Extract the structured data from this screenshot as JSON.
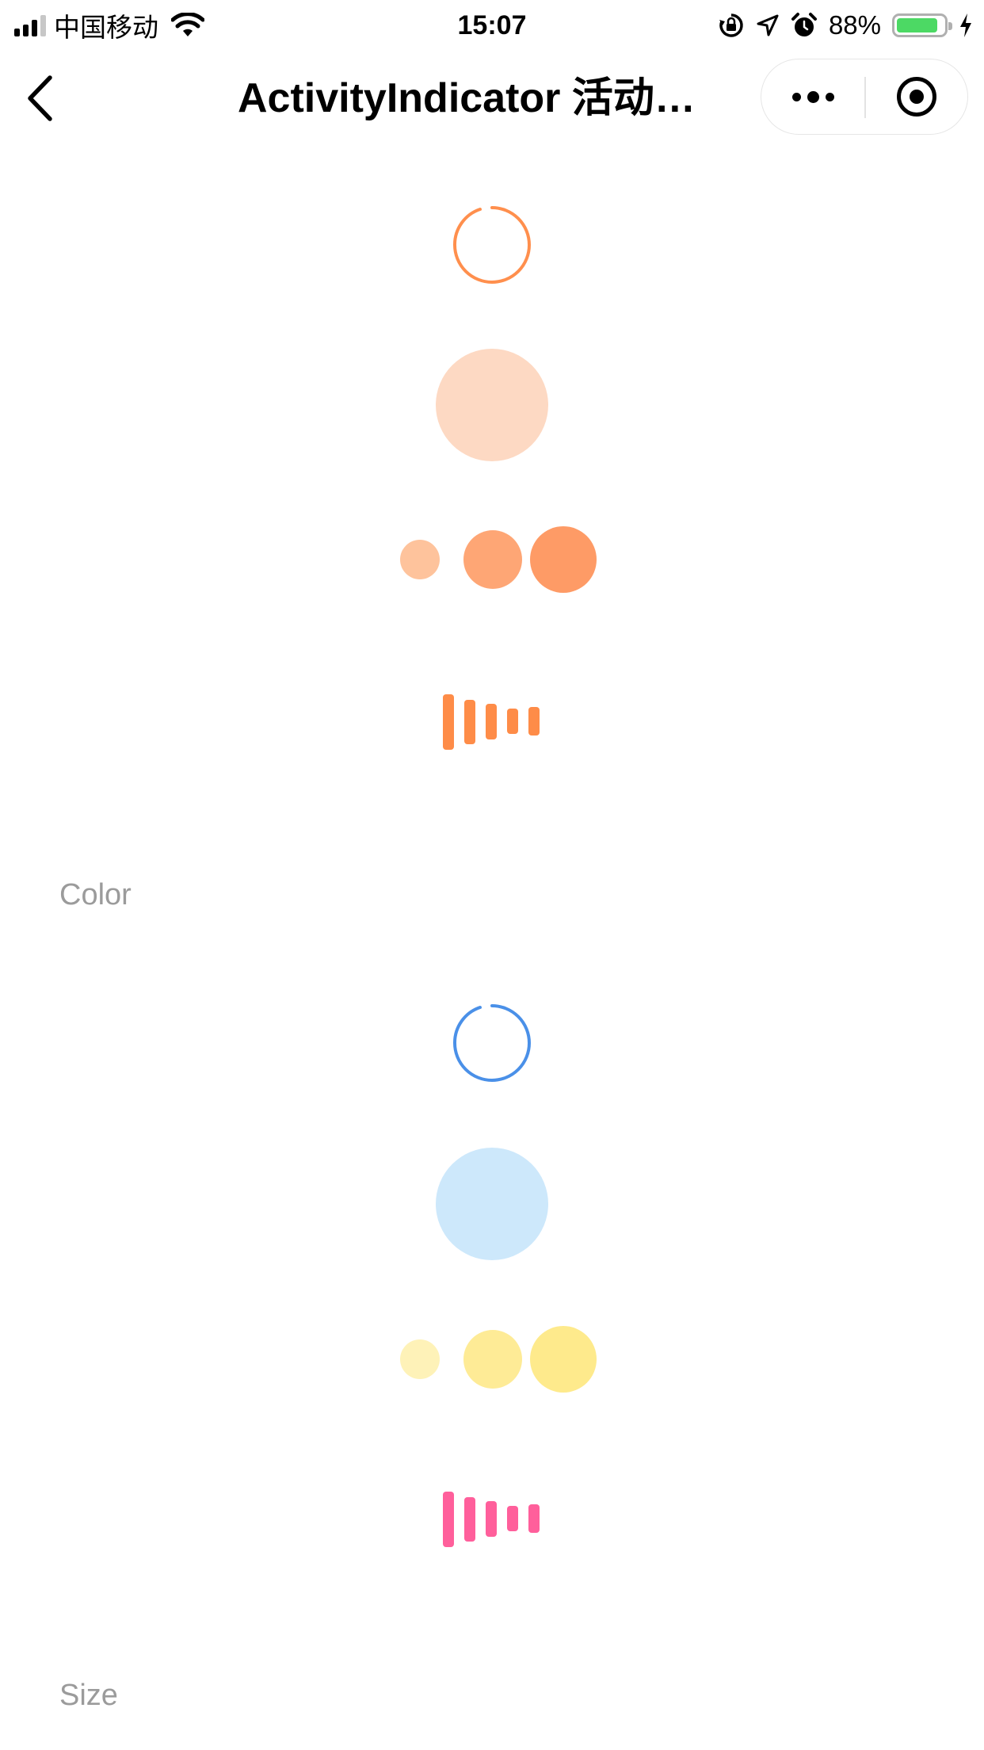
{
  "status_bar": {
    "carrier": "中国移动",
    "time": "15:07",
    "battery_percent": "88%",
    "signal_icon": "signal-bars-icon",
    "wifi_icon": "wifi-icon",
    "rotation_lock_icon": "rotation-lock-icon",
    "location_icon": "location-arrow-icon",
    "alarm_icon": "alarm-clock-icon",
    "charging_icon": "charging-bolt-icon",
    "battery_level": 0.88
  },
  "nav_bar": {
    "title": "ActivityIndicator 活动…",
    "back_icon": "chevron-left-icon",
    "more_icon": "more-dots-icon",
    "close_icon": "target-circle-icon"
  },
  "sections": [
    {
      "label": "",
      "indicators": [
        {
          "type": "spinner",
          "color": "#ff8f4d"
        },
        {
          "type": "pulse",
          "color": "#fdd9c3"
        },
        {
          "type": "dots",
          "colors": [
            "#fec39c",
            "#fea675",
            "#fe9b66"
          ]
        },
        {
          "type": "bars",
          "color": "#fe8c48"
        }
      ]
    },
    {
      "label": "Color",
      "indicators": [
        {
          "type": "spinner",
          "color": "#4a90e8"
        },
        {
          "type": "pulse",
          "color": "#cde8fb"
        },
        {
          "type": "dots",
          "colors": [
            "#fef2b8",
            "#feeb96",
            "#feea8c"
          ]
        },
        {
          "type": "bars",
          "color": "#ff5f9b"
        }
      ]
    },
    {
      "label": "Size"
    }
  ]
}
